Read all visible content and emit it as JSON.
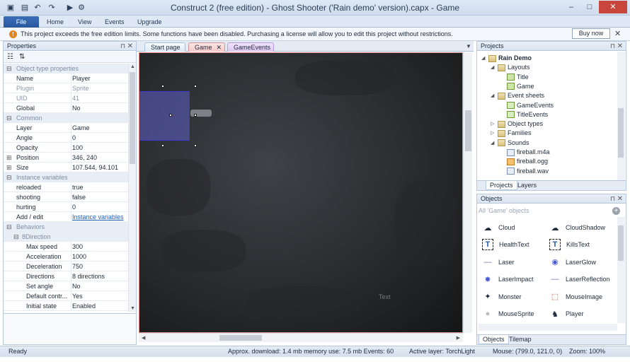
{
  "app": {
    "title": "Construct 2  (free edition) - Ghost Shooter ('Rain demo' version).capx - Game"
  },
  "ribbon": {
    "tabs": [
      "File",
      "Home",
      "View",
      "Events",
      "Upgrade"
    ]
  },
  "infobar": {
    "message": "This project exceeds the free edition limits.  Some functions have been disabled.  Purchasing a license will allow you to edit this project without restrictions.",
    "buy_label": "Buy now"
  },
  "properties": {
    "title": "Properties",
    "rows": [
      {
        "kind": "cat",
        "name": "Object type properties"
      },
      {
        "name": "Name",
        "value": "Player"
      },
      {
        "name": "Plugin",
        "value": "Sprite",
        "disabled": true
      },
      {
        "name": "UID",
        "value": "41",
        "disabled": true
      },
      {
        "name": "Global",
        "value": "No"
      },
      {
        "kind": "cat",
        "name": "Common"
      },
      {
        "name": "Layer",
        "value": "Game"
      },
      {
        "name": "Angle",
        "value": "0"
      },
      {
        "name": "Opacity",
        "value": "100"
      },
      {
        "name": "Position",
        "value": "346, 240",
        "expand": true
      },
      {
        "name": "Size",
        "value": "107.544, 94.101",
        "expand": true
      },
      {
        "kind": "cat",
        "name": "Instance variables"
      },
      {
        "name": "reloaded",
        "value": "true"
      },
      {
        "name": "shooting",
        "value": "false"
      },
      {
        "name": "hurting",
        "value": "0"
      },
      {
        "name": "Add / edit",
        "value": "Instance variables",
        "link": true
      },
      {
        "kind": "cat",
        "name": "Behaviors"
      },
      {
        "kind": "subcat",
        "name": "8Direction"
      },
      {
        "name": "Max speed",
        "value": "300",
        "sub": true
      },
      {
        "name": "Acceleration",
        "value": "1000",
        "sub": true
      },
      {
        "name": "Deceleration",
        "value": "750",
        "sub": true
      },
      {
        "name": "Directions",
        "value": "8 directions",
        "sub": true
      },
      {
        "name": "Set angle",
        "value": "No",
        "sub": true
      },
      {
        "name": "Default contr...",
        "value": "Yes",
        "sub": true
      },
      {
        "name": "Initial state",
        "value": "Enabled",
        "sub": true
      }
    ]
  },
  "document": {
    "tabs": [
      "Start page",
      "Game",
      "GameEvents"
    ],
    "canvas_text": "Text"
  },
  "projects": {
    "title": "Projects",
    "tree": [
      {
        "label": "Rain Demo",
        "level": 0,
        "icon": "folder",
        "bold": true
      },
      {
        "label": "Layouts",
        "level": 1,
        "icon": "folder"
      },
      {
        "label": "Title",
        "level": 2,
        "icon": "layout"
      },
      {
        "label": "Game",
        "level": 2,
        "icon": "layout"
      },
      {
        "label": "Event sheets",
        "level": 1,
        "icon": "folder"
      },
      {
        "label": "GameEvents",
        "level": 2,
        "icon": "sheet"
      },
      {
        "label": "TitleEvents",
        "level": 2,
        "icon": "sheet"
      },
      {
        "label": "Object types",
        "level": 1,
        "icon": "folder",
        "collapsed": true
      },
      {
        "label": "Families",
        "level": 1,
        "icon": "folder",
        "collapsed": true
      },
      {
        "label": "Sounds",
        "level": 1,
        "icon": "folder"
      },
      {
        "label": "fireball.m4a",
        "level": 2,
        "icon": "sound"
      },
      {
        "label": "fireball.ogg",
        "level": 2,
        "icon": "ogg"
      },
      {
        "label": "fireball.wav",
        "level": 2,
        "icon": "sound"
      }
    ],
    "tabs": [
      "Projects",
      "Layers"
    ]
  },
  "objects": {
    "title": "Objects",
    "filter": "All 'Game' objects",
    "items": [
      {
        "label": "Cloud",
        "icon": "cloud-icon"
      },
      {
        "label": "CloudShadow",
        "icon": "cloud-shadow-icon"
      },
      {
        "label": "HealthText",
        "icon": "text-icon"
      },
      {
        "label": "KillsText",
        "icon": "text-icon"
      },
      {
        "label": "Laser",
        "icon": "laser-icon"
      },
      {
        "label": "LaserGlow",
        "icon": "glow-icon"
      },
      {
        "label": "LaserImpact",
        "icon": "impact-icon"
      },
      {
        "label": "LaserReflection",
        "icon": "laser-icon"
      },
      {
        "label": "Monster",
        "icon": "monster-icon"
      },
      {
        "label": "MouseImage",
        "icon": "mouse-image-icon"
      },
      {
        "label": "MouseSprite",
        "icon": "mouse-sprite-icon"
      },
      {
        "label": "Player",
        "icon": "player-icon"
      }
    ],
    "tabs": [
      "Objects",
      "Tilemap"
    ]
  },
  "status": {
    "ready": "Ready",
    "memory": "Approx. download: 1.4 mb  memory use: 7.5 mb  Events: 60",
    "active_layer": "Active layer: TorchLight",
    "mouse": "Mouse: (799.0, 121.0, 0)",
    "zoom": "Zoom: 100%"
  }
}
